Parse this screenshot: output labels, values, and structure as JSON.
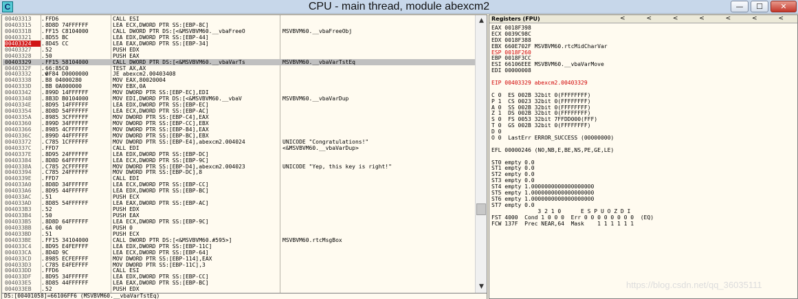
{
  "app": {
    "title": "CPU - main thread, module abexcm2",
    "icon_letter": "C"
  },
  "window_buttons": {
    "minimize": "—",
    "maximize": "☐",
    "close": "✕"
  },
  "disasm": {
    "rows": [
      {
        "addr": "00403313",
        "mark": ".",
        "hex": "FFD6",
        "dis": "CALL ESI",
        "comment": ""
      },
      {
        "addr": "00403315",
        "mark": ".",
        "hex": "8D8D 74FFFFFF",
        "dis": "LEA ECX,DWORD PTR SS:[EBP-8C]",
        "comment": ""
      },
      {
        "addr": "0040331B",
        "mark": ".",
        "hex": "FF15 C8104000",
        "dis": "CALL DWORD PTR DS:[<&MSVBVM60.__vbaFreeO",
        "comment": "MSVBVM60.__vbaFreeObj"
      },
      {
        "addr": "00403321",
        "mark": ".",
        "hex": "8D55 BC",
        "dis": "LEA EDX,DWORD PTR SS:[EBP-44]",
        "comment": ""
      },
      {
        "addr": "00403324",
        "mark": ".",
        "hex": "8D45 CC",
        "dis": "LEA EAX,DWORD PTR SS:[EBP-34]",
        "comment": "",
        "bp": true
      },
      {
        "addr": "00403327",
        "mark": ".",
        "hex": "52",
        "dis": "PUSH EDX",
        "comment": ""
      },
      {
        "addr": "00403328",
        "mark": ".",
        "hex": "50",
        "dis": "PUSH EAX",
        "comment": ""
      },
      {
        "addr": "00403329",
        "mark": ".",
        "hex": "FF15 58104000",
        "dis": "CALL DWORD PTR DS:[<&MSVBVM60.__vbaVarTs",
        "comment": "MSVBVM60.__vbaVarTstEq",
        "sel": true
      },
      {
        "addr": "0040332F",
        "mark": ".",
        "hex": "66:85C0",
        "dis": "TEST AX,AX",
        "comment": ""
      },
      {
        "addr": "00403332",
        "mark": ".v",
        "hex": "0F84 D0000000",
        "dis": "JE abexcm2.00403408",
        "comment": ""
      },
      {
        "addr": "00403338",
        "mark": ".",
        "hex": "B8 04000280",
        "dis": "MOV EAX,80020004",
        "comment": ""
      },
      {
        "addr": "0040333D",
        "mark": ".",
        "hex": "BB 0A000000",
        "dis": "MOV EBX,0A",
        "comment": ""
      },
      {
        "addr": "00403342",
        "mark": ".",
        "hex": "899D 14FFFFFF",
        "dis": "MOV DWORD PTR SS:[EBP-EC],EDI",
        "comment": ""
      },
      {
        "addr": "00403348",
        "mark": ".",
        "hex": "8B3D B0104000",
        "dis": "MOV EDI,DWORD PTR DS:[<&MSVBVM60.__vbaV",
        "comment": "MSVBVM60.__vbaVarDup"
      },
      {
        "addr": "0040334E",
        "mark": ".",
        "hex": "8D95 14FFFFFF",
        "dis": "LEA EDX,DWORD PTR SS:[EBP-EC]",
        "comment": ""
      },
      {
        "addr": "00403354",
        "mark": ".",
        "hex": "8D8D 54FFFFFF",
        "dis": "LEA ECX,DWORD PTR SS:[EBP-AC]",
        "comment": ""
      },
      {
        "addr": "0040335A",
        "mark": ".",
        "hex": "8985 3CFFFFFF",
        "dis": "MOV DWORD PTR SS:[EBP-C4],EAX",
        "comment": ""
      },
      {
        "addr": "00403360",
        "mark": ".",
        "hex": "899D 34FFFFFF",
        "dis": "MOV DWORD PTR SS:[EBP-CC],EBX",
        "comment": ""
      },
      {
        "addr": "00403366",
        "mark": ".",
        "hex": "8985 4CFFFFFF",
        "dis": "MOV DWORD PTR SS:[EBP-B4],EAX",
        "comment": ""
      },
      {
        "addr": "0040336C",
        "mark": ".",
        "hex": "899D 44FFFFFF",
        "dis": "MOV DWORD PTR SS:[EBP-BC],EBX",
        "comment": ""
      },
      {
        "addr": "00403372",
        "mark": ".",
        "hex": "C785 1CFFFFFF",
        "dis": "MOV DWORD PTR SS:[EBP-E4],abexcm2.004024",
        "comment": "UNICODE \"Congratulations!\""
      },
      {
        "addr": "0040337C",
        "mark": ".",
        "hex": "FFD7",
        "dis": "CALL EDI",
        "comment": "<&MSVBVM60.__vbaVarDup>"
      },
      {
        "addr": "0040337E",
        "mark": ".",
        "hex": "8D95 24FFFFFF",
        "dis": "LEA EDX,DWORD PTR SS:[EBP-DC]",
        "comment": ""
      },
      {
        "addr": "00403384",
        "mark": ".",
        "hex": "8D8D 64FFFFFF",
        "dis": "LEA ECX,DWORD PTR SS:[EBP-9C]",
        "comment": ""
      },
      {
        "addr": "0040338A",
        "mark": ".",
        "hex": "C785 2CFFFFFF",
        "dis": "MOV DWORD PTR SS:[EBP-D4],abexcm2.004023",
        "comment": "UNICODE \"Yep, this key is right!\""
      },
      {
        "addr": "00403394",
        "mark": ".",
        "hex": "C785 24FFFFFF",
        "dis": "MOV DWORD PTR SS:[EBP-DC],8",
        "comment": ""
      },
      {
        "addr": "0040339E",
        "mark": ".",
        "hex": "FFD7",
        "dis": "CALL EDI",
        "comment": ""
      },
      {
        "addr": "004033A0",
        "mark": ".",
        "hex": "8D8D 34FFFFFF",
        "dis": "LEA ECX,DWORD PTR SS:[EBP-CC]",
        "comment": ""
      },
      {
        "addr": "004033A6",
        "mark": ".",
        "hex": "8D95 44FFFFFF",
        "dis": "LEA EDX,DWORD PTR SS:[EBP-BC]",
        "comment": ""
      },
      {
        "addr": "004033AC",
        "mark": ".",
        "hex": "51",
        "dis": "PUSH ECX",
        "comment": ""
      },
      {
        "addr": "004033AD",
        "mark": ".",
        "hex": "8D85 54FFFFFF",
        "dis": "LEA EAX,DWORD PTR SS:[EBP-AC]",
        "comment": ""
      },
      {
        "addr": "004033B3",
        "mark": ".",
        "hex": "52",
        "dis": "PUSH EDX",
        "comment": ""
      },
      {
        "addr": "004033B4",
        "mark": ".",
        "hex": "50",
        "dis": "PUSH EAX",
        "comment": ""
      },
      {
        "addr": "004033B5",
        "mark": ".",
        "hex": "8D8D 64FFFFFF",
        "dis": "LEA ECX,DWORD PTR SS:[EBP-9C]",
        "comment": ""
      },
      {
        "addr": "004033BB",
        "mark": ".",
        "hex": "6A 00",
        "dis": "PUSH 0",
        "comment": ""
      },
      {
        "addr": "004033BD",
        "mark": ".",
        "hex": "51",
        "dis": "PUSH ECX",
        "comment": ""
      },
      {
        "addr": "004033BE",
        "mark": ".",
        "hex": "FF15 34104000",
        "dis": "CALL DWORD PTR DS:[<&MSVBVM60.#595>]",
        "comment": "MSVBVM60.rtcMsgBox"
      },
      {
        "addr": "004033C4",
        "mark": ".",
        "hex": "8D95 E4FEFFFF",
        "dis": "LEA EDX,DWORD PTR SS:[EBP-11C]",
        "comment": ""
      },
      {
        "addr": "004033CA",
        "mark": ".",
        "hex": "8D4D 9C",
        "dis": "LEA ECX,DWORD PTR SS:[EBP-64]",
        "comment": ""
      },
      {
        "addr": "004033CD",
        "mark": ".",
        "hex": "8985 ECFEFFFF",
        "dis": "MOV DWORD PTR SS:[EBP-114],EAX",
        "comment": ""
      },
      {
        "addr": "004033D3",
        "mark": ".",
        "hex": "C785 E4FEFFFF",
        "dis": "MOV DWORD PTR SS:[EBP-11C],3",
        "comment": ""
      },
      {
        "addr": "004033DD",
        "mark": ".",
        "hex": "FFD6",
        "dis": "CALL ESI",
        "comment": ""
      },
      {
        "addr": "004033DF",
        "mark": ".",
        "hex": "8D95 34FFFFFF",
        "dis": "LEA EDX,DWORD PTR SS:[EBP-CC]",
        "comment": ""
      },
      {
        "addr": "004033E5",
        "mark": ".",
        "hex": "8D85 44FFFFFF",
        "dis": "LEA EAX,DWORD PTR SS:[EBP-BC]",
        "comment": ""
      },
      {
        "addr": "004033EB",
        "mark": ".",
        "hex": "52",
        "dis": "PUSH EDX",
        "comment": ""
      }
    ],
    "status": "DS:[00401058]=66106FF6 (MSVBVM60.__vbaVarTstEq)"
  },
  "registers": {
    "header": "Registers (FPU)",
    "nav_arrows": "< < < < < < <",
    "lines": [
      {
        "text": "EAX 0018F398",
        "red": false
      },
      {
        "text": "ECX 0039C98C",
        "red": false
      },
      {
        "text": "EDX 0018F388",
        "red": false
      },
      {
        "text": "EBX 660E702F MSVBVM60.rtcMidCharVar",
        "red": false
      },
      {
        "text": "ESP 0018F260",
        "red": true
      },
      {
        "text": "EBP 0018F3CC",
        "red": false
      },
      {
        "text": "ESI 66106EEE MSVBVM60.__vbaVarMove",
        "red": false
      },
      {
        "text": "EDI 00000008",
        "red": false
      },
      {
        "text": "",
        "red": false
      },
      {
        "text": "EIP 00403329 abexcm2.00403329",
        "red": true
      },
      {
        "text": "",
        "red": false
      },
      {
        "text": "C 0  ES 002B 32bit 0(FFFFFFFF)",
        "red": false
      },
      {
        "text": "P 1  CS 0023 32bit 0(FFFFFFFF)",
        "red": false
      },
      {
        "text": "A 0  SS 002B 32bit 0(FFFFFFFF)",
        "red": false
      },
      {
        "text": "Z 1  DS 002B 32bit 0(FFFFFFFF)",
        "red": false
      },
      {
        "text": "S 0  FS 0053 32bit 7FFDD000(FFF)",
        "red": false
      },
      {
        "text": "T 0  GS 002B 32bit 0(FFFFFFFF)",
        "red": false
      },
      {
        "text": "D 0",
        "red": false
      },
      {
        "text": "O 0  LastErr ERROR_SUCCESS (00000000)",
        "red": false
      },
      {
        "text": "",
        "red": false
      },
      {
        "text": "EFL 00000246 (NO,NB,E,BE,NS,PE,GE,LE)",
        "red": false
      },
      {
        "text": "",
        "red": false
      },
      {
        "text": "ST0 empty 0.0",
        "red": false
      },
      {
        "text": "ST1 empty 0.0",
        "red": false
      },
      {
        "text": "ST2 empty 0.0",
        "red": false
      },
      {
        "text": "ST3 empty 0.0",
        "red": false
      },
      {
        "text": "ST4 empty 1.0000000000000000000",
        "red": false
      },
      {
        "text": "ST5 empty 1.0000000000000000000",
        "red": false
      },
      {
        "text": "ST6 empty 1.0000000000000000000",
        "red": false
      },
      {
        "text": "ST7 empty 0.0",
        "red": false
      },
      {
        "text": "              3 2 1 0      E S P U O Z D I",
        "red": false
      },
      {
        "text": "FST 4000  Cond 1 0 0 0  Err 0 0 0 0 0 0 0 0  (EQ)",
        "red": false
      },
      {
        "text": "FCW 137F  Prec NEAR,64  Mask    1 1 1 1 1 1",
        "red": false
      }
    ]
  },
  "watermark": "https://blog.csdn.net/qq_36035111"
}
